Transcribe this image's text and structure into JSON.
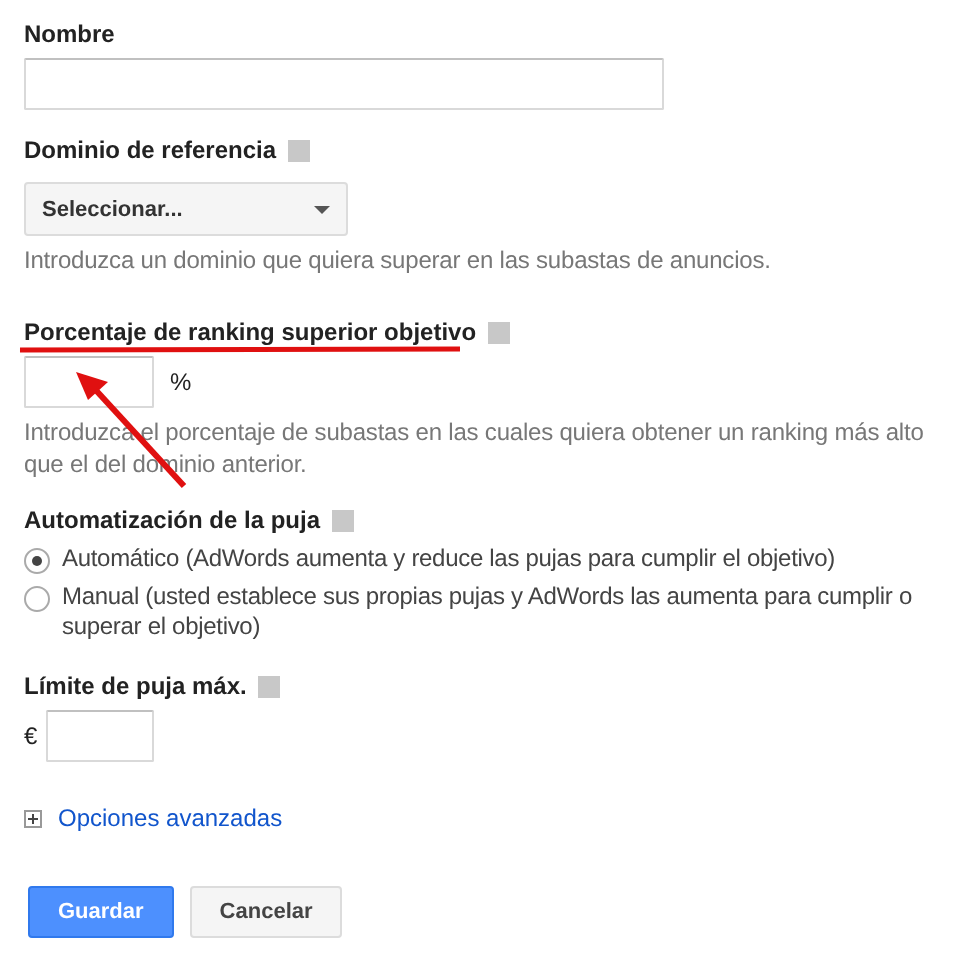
{
  "name_field": {
    "label": "Nombre"
  },
  "domain_field": {
    "label": "Dominio de referencia",
    "value": "Seleccionar...",
    "help": "Introduzca un dominio que quiera superar en las subastas de anuncios."
  },
  "percent_field": {
    "label": "Porcentaje de ranking superior objetivo",
    "suffix": "%",
    "help": "Introduzca el porcentaje de subastas en las cuales quiera obtener un ranking más alto que el del dominio anterior."
  },
  "bid_automation": {
    "label": "Automatización de la puja",
    "options": [
      {
        "label": "Automático (AdWords aumenta y reduce las pujas para cumplir el objetivo)",
        "selected": true
      },
      {
        "label": "Manual (usted establece sus propias pujas y AdWords las aumenta para cumplir o superar el objetivo)",
        "selected": false
      }
    ]
  },
  "max_bid": {
    "label": "Límite de puja máx.",
    "prefix": "€"
  },
  "advanced_link": "Opciones avanzadas",
  "buttons": [
    {
      "label": "Guardar",
      "kind": "primary"
    },
    {
      "label": "Cancelar",
      "kind": "secondary"
    }
  ],
  "annotations": {
    "label_underline": true,
    "arrow_to_field": true
  }
}
